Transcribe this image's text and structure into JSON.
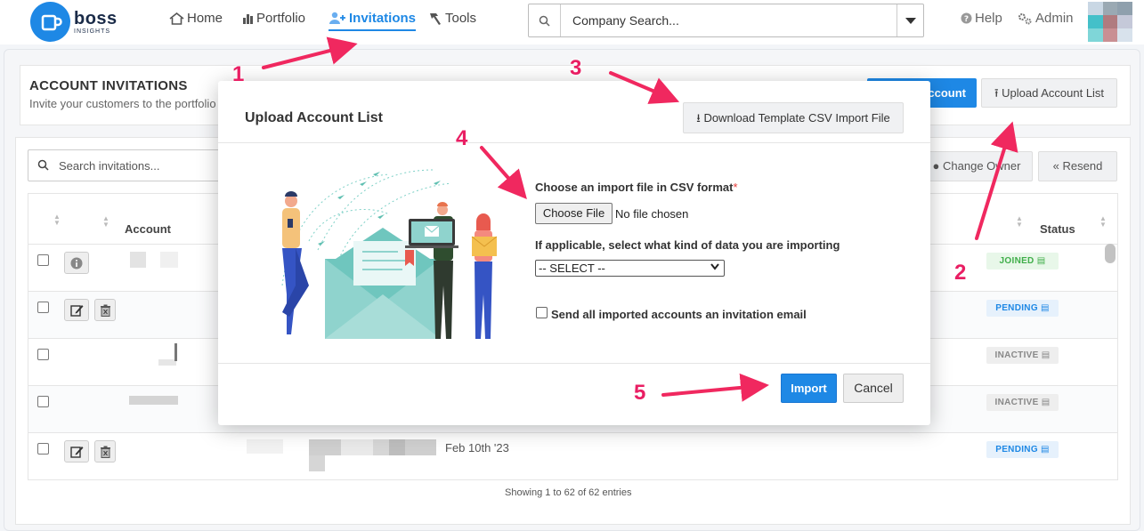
{
  "brand": {
    "name": "boss",
    "tagline": "INSIGHTS"
  },
  "nav": [
    {
      "label": "Home",
      "icon": "home-icon"
    },
    {
      "label": "Portfolio",
      "icon": "bar-chart-icon"
    },
    {
      "label": "Invitations",
      "icon": "add-user-icon",
      "active": true
    },
    {
      "label": "Tools",
      "icon": "hammer-icon"
    }
  ],
  "search": {
    "placeholder": "Company Search..."
  },
  "top_right": {
    "help": "Help",
    "admin": "Admin"
  },
  "page": {
    "title": "ACCOUNT INVITATIONS",
    "subtitle": "Invite your customers to the portfolio",
    "add_button": "ccount",
    "upload_button": "Upload Account List",
    "invitation_search_placeholder": "Search invitations...",
    "change_owner": "Change Owner",
    "resend": "Resend"
  },
  "table": {
    "columns": {
      "account": "Account",
      "status": "Status"
    },
    "rows": [
      {
        "status": "JOINED",
        "kind": "joined"
      },
      {
        "status": "PENDING",
        "kind": "pending"
      },
      {
        "status": "INACTIVE",
        "kind": "inactive"
      },
      {
        "status": "INACTIVE",
        "kind": "inactive"
      },
      {
        "status": "PENDING",
        "kind": "pending",
        "date": "Feb 10th '23"
      }
    ],
    "footer": "Showing 1 to 62 of 62 entries"
  },
  "modal": {
    "title": "Upload Account List",
    "download_button": "Download Template CSV Import File",
    "file_label": "Choose an import file in CSV format",
    "required_mark": "*",
    "choose_button": "Choose File",
    "no_file": "No file chosen",
    "kind_label": "If applicable, select what kind of data you are importing",
    "select_value": "-- SELECT --",
    "email_label": "Send all imported accounts an invitation email",
    "import_button": "Import",
    "cancel_button": "Cancel"
  },
  "annotations": [
    "1",
    "2",
    "3",
    "4",
    "5"
  ],
  "colors": {
    "accent": "#1e88e5",
    "annotation": "#e91e63",
    "joined": "#3fae49"
  }
}
